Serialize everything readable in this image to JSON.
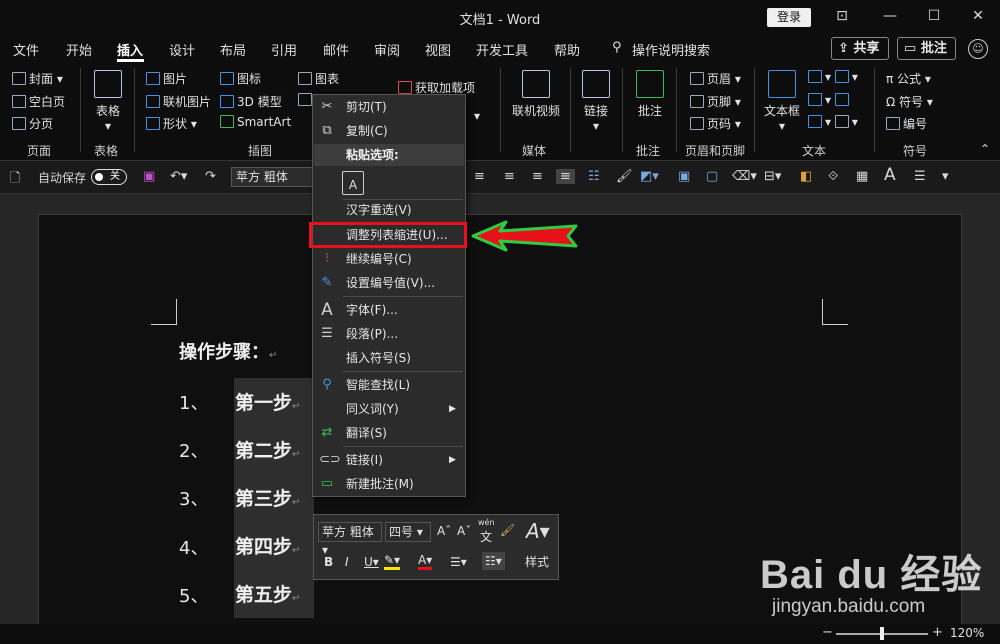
{
  "window": {
    "title": "文档1  -  Word",
    "login": "登录",
    "controls": [
      "⊡",
      "—",
      "☐",
      "✕"
    ]
  },
  "menu": {
    "tabs": [
      "文件",
      "开始",
      "插入",
      "设计",
      "布局",
      "引用",
      "邮件",
      "审阅",
      "视图",
      "开发工具",
      "帮助"
    ],
    "search": "操作说明搜索",
    "share": "共享",
    "comment": "批注",
    "smiley": "☺"
  },
  "ribbon": {
    "pages": {
      "cover": "封面",
      "blank": "空白页",
      "break": "分页",
      "group": "页面"
    },
    "table": {
      "label": "表格",
      "group": "表格"
    },
    "illustrations": {
      "picture": "图片",
      "online_picture": "联机图片",
      "shapes": "形状",
      "icons": "图标",
      "model3d": "3D 模型",
      "smartart": "SmartArt",
      "chart": "图表",
      "group": "插图"
    },
    "addins": {
      "get": "获取加载项"
    },
    "media": {
      "video": "联机视频",
      "group": "媒体"
    },
    "links": {
      "link": "链接"
    },
    "comments": {
      "comment": "批注",
      "group": "批注"
    },
    "header_footer": {
      "header": "页眉",
      "footer": "页脚",
      "page_number": "页码",
      "group": "页眉和页脚"
    },
    "text": {
      "textbox": "文本框",
      "group": "文本"
    },
    "symbols": {
      "equation": "公式",
      "symbol": "符号",
      "numbering": "编号",
      "group": "符号"
    }
  },
  "qat": {
    "autosave": "自动保存",
    "toggle": "关",
    "font": "苹方 粗体"
  },
  "document": {
    "heading": "操作步骤：",
    "items": [
      {
        "num": "1、",
        "text": "第一步"
      },
      {
        "num": "2、",
        "text": "第二步"
      },
      {
        "num": "3、",
        "text": "第三步"
      },
      {
        "num": "4、",
        "text": "第四步"
      },
      {
        "num": "5、",
        "text": "第五步"
      }
    ],
    "pilcrow": "↵"
  },
  "context_menu": {
    "cut": "剪切(T)",
    "copy": "复制(C)",
    "paste_options": "粘贴选项:",
    "reconvert": "汉字重选(V)",
    "adjust_indent": "调整列表缩进(U)...",
    "continue_numbering": "继续编号(C)",
    "set_numbering": "设置编号值(V)...",
    "font": "字体(F)...",
    "paragraph": "段落(P)...",
    "insert_symbol": "插入符号(S)",
    "smart_lookup": "智能查找(L)",
    "synonyms": "同义词(Y)",
    "translate": "翻译(S)",
    "link": "链接(I)",
    "new_comment": "新建批注(M)"
  },
  "mini_toolbar": {
    "font": "苹方 粗体",
    "size": "四号",
    "styles": "样式",
    "phonetic": "wén"
  },
  "status": {
    "zoom": "120%"
  },
  "watermark": {
    "logo": "Bai du 经验",
    "url": "jingyan.baidu.com"
  },
  "colors": {
    "highlight": "#e8101a",
    "arrow_fill": "#e8101a",
    "arrow_outline": "#2ecc40",
    "accent": "#4a90e2"
  }
}
